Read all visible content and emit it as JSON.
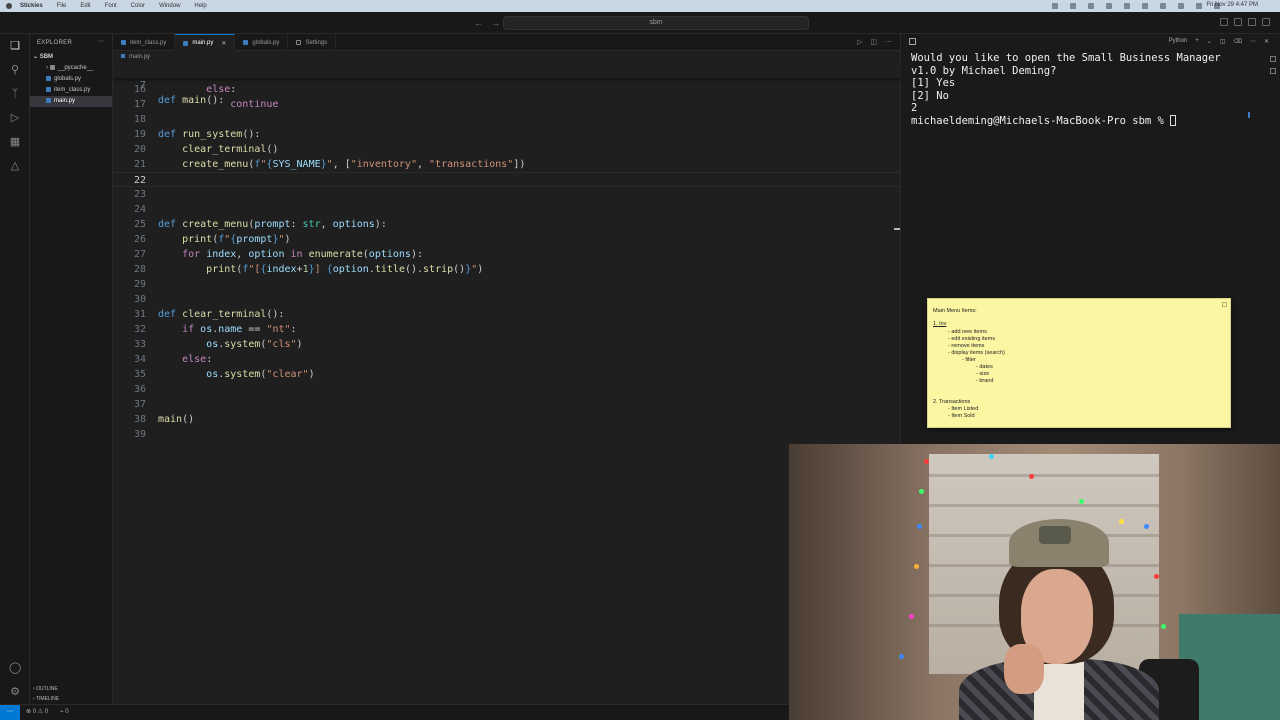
{
  "menubar": {
    "app": "Stickies",
    "items": [
      "File",
      "Edit",
      "Font",
      "Color",
      "Window",
      "Help"
    ],
    "clock": "Fri Nov 29 4:47 PM"
  },
  "titlebar": {
    "command_center": "sbm"
  },
  "sidebar": {
    "header": "EXPLORER",
    "root": "SBM",
    "items": [
      {
        "label": "__pycache__",
        "color": "#8a8a8a"
      },
      {
        "label": "globals.py",
        "color": "#3c7dbf"
      },
      {
        "label": "item_class.py",
        "color": "#3c7dbf"
      },
      {
        "label": "main.py",
        "color": "#3c7dbf"
      }
    ],
    "outline": "OUTLINE",
    "timeline": "TIMELINE"
  },
  "tabs": [
    {
      "label": "item_class.py"
    },
    {
      "label": "main.py"
    },
    {
      "label": "globals.py"
    },
    {
      "label": "Settings"
    }
  ],
  "breadcrumb": "main.py",
  "editor": {
    "sticky": {
      "num": "7",
      "code": "def main():"
    },
    "lines": [
      {
        "num": "16",
        "code": "        else:"
      },
      {
        "num": "17",
        "code": "            continue"
      },
      {
        "num": "18",
        "code": ""
      },
      {
        "num": "19",
        "code": "def run_system():"
      },
      {
        "num": "20",
        "code": "    clear_terminal()"
      },
      {
        "num": "21",
        "code": "    create_menu(f\"{SYS_NAME}\", [\"inventory\", \"transactions\"])"
      },
      {
        "num": "22",
        "code": ""
      },
      {
        "num": "23",
        "code": ""
      },
      {
        "num": "24",
        "code": ""
      },
      {
        "num": "25",
        "code": "def create_menu(prompt: str, options):"
      },
      {
        "num": "26",
        "code": "    print(f\"{prompt}\")"
      },
      {
        "num": "27",
        "code": "    for index, option in enumerate(options):"
      },
      {
        "num": "28",
        "code": "        print(f\"[{index+1}] {option.title().strip()}\")"
      },
      {
        "num": "29",
        "code": ""
      },
      {
        "num": "30",
        "code": ""
      },
      {
        "num": "31",
        "code": "def clear_terminal():"
      },
      {
        "num": "32",
        "code": "    if os.name == \"nt\":"
      },
      {
        "num": "33",
        "code": "        os.system(\"cls\")"
      },
      {
        "num": "34",
        "code": "    else:"
      },
      {
        "num": "35",
        "code": "        os.system(\"clear\")"
      },
      {
        "num": "36",
        "code": ""
      },
      {
        "num": "37",
        "code": ""
      },
      {
        "num": "38",
        "code": "main()"
      },
      {
        "num": "39",
        "code": ""
      }
    ]
  },
  "terminal": {
    "header": "Python",
    "lines": [
      "Would you like to open the Small Business Manager",
      "v1.0 by Michael Deming?",
      "[1] Yes",
      "[2] No",
      "2"
    ],
    "prompt": "michaeldeming@Michaels-MacBook-Pro sbm % "
  },
  "note": {
    "lines": [
      "Main Menu Items:",
      "1. Inv",
      "- add new items",
      "- edit existing items",
      "- remove items",
      "- display items (search)",
      "- filter",
      "- dates",
      "- size",
      "- brand",
      "2. Transactions",
      "- Item Listed",
      "- Item Sold"
    ]
  },
  "statusbar": {
    "problems": "⊗ 0 ⚠ 0",
    "ports": "⌁ 0"
  }
}
